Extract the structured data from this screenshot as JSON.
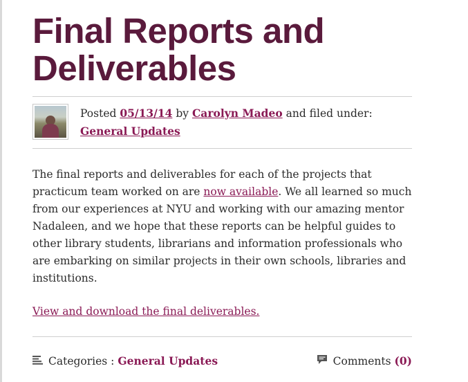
{
  "post": {
    "title_line1": "Final Reports and",
    "title_line2": "Deliverables",
    "meta": {
      "posted_label": "Posted",
      "date": "05/13/14",
      "by_label": "by",
      "author": "Carolyn Madeo",
      "filed_label": "and filed under:",
      "category": "General Updates"
    },
    "body": {
      "p1_before": "The final reports and deliverables for each of the projects that practicum team worked on are ",
      "p1_link": "now available",
      "p1_after": ". We all learned so much from our experiences at NYU and working with our amazing mentor Nadaleen, and we hope that these reports can be helpful guides to other library students, librarians and information professionals who are embarking on similar projects in their own schools, libraries and institutions.",
      "download_link": "View and download the final deliverables."
    },
    "footer": {
      "categories_label": "Categories :",
      "category": "General Updates",
      "comments_label": "Comments",
      "comments_count": "(0)"
    }
  },
  "colors": {
    "title": "#5a1a3c",
    "link": "#8a1a55",
    "text": "#2b2b2b",
    "rule": "#cfcfcf"
  },
  "icons": {
    "categories": "list-lines-icon",
    "comments": "speech-bubble-icon"
  }
}
